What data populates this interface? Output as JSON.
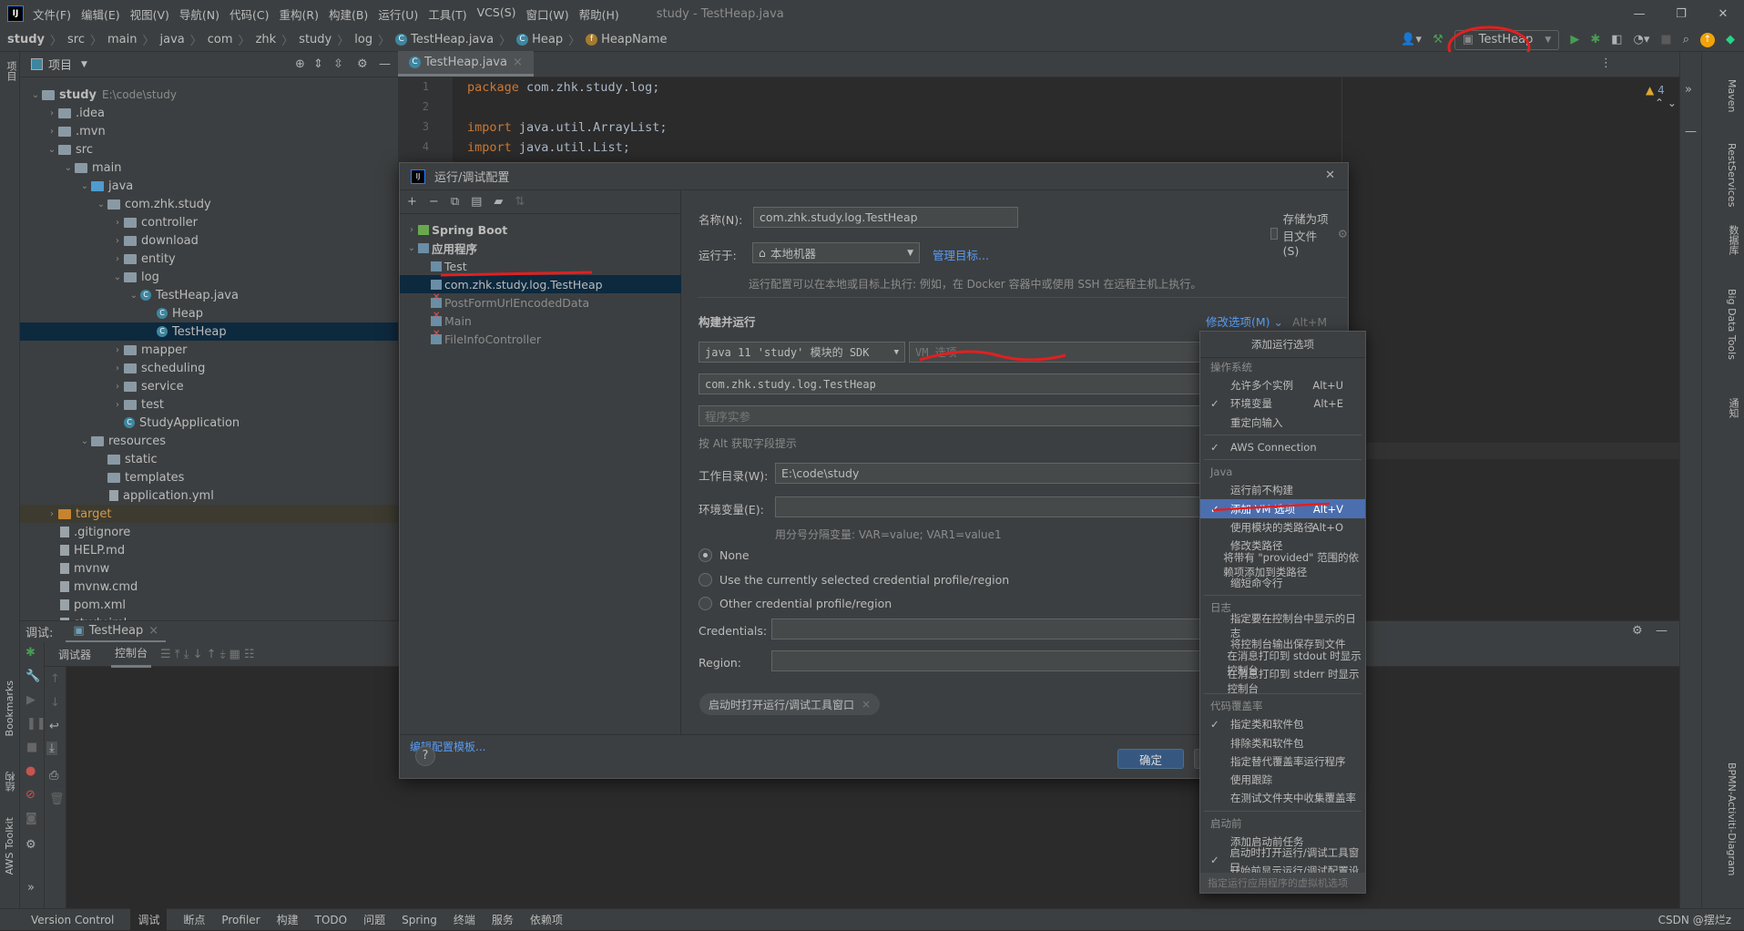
{
  "menubar": {
    "items": [
      "文件(F)",
      "编辑(E)",
      "视图(V)",
      "导航(N)",
      "代码(C)",
      "重构(R)",
      "构建(B)",
      "运行(U)",
      "工具(T)",
      "VCS(S)",
      "窗口(W)",
      "帮助(H)"
    ],
    "window_title": "study - TestHeap.java",
    "logo": "IJ"
  },
  "breadcrumb": [
    "study",
    "src",
    "main",
    "java",
    "com",
    "zhk",
    "study",
    "log",
    "TestHeap.java",
    "Heap",
    "HeapName"
  ],
  "toolbar": {
    "run_config": "TestHeap",
    "warnings": "4"
  },
  "project": {
    "title": "项目",
    "tree": [
      {
        "label": "study",
        "extra": "E:\\code\\study",
        "level": 0,
        "type": "folder",
        "open": true
      },
      {
        "label": ".idea",
        "level": 1,
        "type": "folder",
        "open": false
      },
      {
        "label": ".mvn",
        "level": 1,
        "type": "folder",
        "open": false
      },
      {
        "label": "src",
        "level": 1,
        "type": "folder",
        "open": true
      },
      {
        "label": "main",
        "level": 2,
        "type": "folder",
        "open": true
      },
      {
        "label": "java",
        "level": 3,
        "type": "src",
        "open": true
      },
      {
        "label": "com.zhk.study",
        "level": 4,
        "type": "folder",
        "open": true
      },
      {
        "label": "controller",
        "level": 5,
        "type": "folder",
        "open": false
      },
      {
        "label": "download",
        "level": 5,
        "type": "folder",
        "open": false
      },
      {
        "label": "entity",
        "level": 5,
        "type": "folder",
        "open": false
      },
      {
        "label": "log",
        "level": 5,
        "type": "folder",
        "open": true
      },
      {
        "label": "TestHeap.java",
        "level": 6,
        "type": "class",
        "open": true
      },
      {
        "label": "Heap",
        "level": 7,
        "type": "class"
      },
      {
        "label": "TestHeap",
        "level": 7,
        "type": "class",
        "selected": true
      },
      {
        "label": "mapper",
        "level": 5,
        "type": "folder",
        "open": false
      },
      {
        "label": "scheduling",
        "level": 5,
        "type": "folder",
        "open": false
      },
      {
        "label": "service",
        "level": 5,
        "type": "folder",
        "open": false
      },
      {
        "label": "test",
        "level": 5,
        "type": "folder",
        "open": false
      },
      {
        "label": "StudyApplication",
        "level": 5,
        "type": "class"
      },
      {
        "label": "resources",
        "level": 3,
        "type": "folder",
        "open": true
      },
      {
        "label": "static",
        "level": 4,
        "type": "folder"
      },
      {
        "label": "templates",
        "level": 4,
        "type": "folder"
      },
      {
        "label": "application.yml",
        "level": 4,
        "type": "file"
      },
      {
        "label": "target",
        "level": 1,
        "type": "target",
        "open": false,
        "ignored": true
      },
      {
        "label": ".gitignore",
        "level": 1,
        "type": "file"
      },
      {
        "label": "HELP.md",
        "level": 1,
        "type": "file"
      },
      {
        "label": "mvnw",
        "level": 1,
        "type": "file"
      },
      {
        "label": "mvnw.cmd",
        "level": 1,
        "type": "file"
      },
      {
        "label": "pom.xml",
        "level": 1,
        "type": "file"
      },
      {
        "label": "study.iml",
        "level": 1,
        "type": "file"
      }
    ]
  },
  "editor": {
    "tab": "TestHeap.java",
    "lines": [
      {
        "n": "1",
        "kw": "package",
        "rest": " com.zhk.study.log;"
      },
      {
        "n": "2",
        "kw": "",
        "rest": ""
      },
      {
        "n": "3",
        "kw": "import",
        "rest": " java.util.ArrayList;"
      },
      {
        "n": "4",
        "kw": "import",
        "rest": " java.util.List;"
      }
    ]
  },
  "left_strip": [
    "项目",
    "Bookmarks",
    "结构",
    "AWS Toolkit"
  ],
  "right_strip": [
    "Maven",
    "RestServices",
    "数据库",
    "Big Data Tools",
    "通知",
    "BPMN-Activiti-Diagram"
  ],
  "debug": {
    "label": "调试:",
    "tab": "TestHeap",
    "subtabs": [
      "调试器",
      "控制台"
    ]
  },
  "statusbar": {
    "items": [
      "Version Control",
      "调试",
      "断点",
      "Profiler",
      "构建",
      "TODO",
      "问题",
      "Spring",
      "终端",
      "服务",
      "依赖项"
    ],
    "watermark": "CSDN @摆烂z"
  },
  "dialog": {
    "title": "运行/调试配置",
    "tree": [
      {
        "label": "Spring Boot",
        "level": 0,
        "group": true
      },
      {
        "label": "应用程序",
        "level": 0,
        "group": true,
        "open": true
      },
      {
        "label": "Test",
        "level": 1
      },
      {
        "label": "com.zhk.study.log.TestHeap",
        "level": 1,
        "selected": true
      },
      {
        "label": "PostFormUrlEncodedData",
        "level": 1,
        "error": true
      },
      {
        "label": "Main",
        "level": 1,
        "error": true
      },
      {
        "label": "FileInfoController",
        "level": 1,
        "error": true
      }
    ],
    "edit_templates": "编辑配置模板...",
    "name_label": "名称(N):",
    "name_value": "com.zhk.study.log.TestHeap",
    "store_label": "存储为项目文件(S)",
    "run_on_label": "运行于:",
    "run_on_value": "本地机器",
    "manage_targets": "管理目标...",
    "run_on_hint": "运行配置可以在本地或目标上执行: 例如，在 Docker 容器中或使用 SSH 在远程主机上执行。",
    "build_run": "构建并运行",
    "modify_options": "修改选项(M)",
    "modify_shortcut": "Alt+M",
    "jdk": "java 11 'study' 模块的 SDK",
    "vm_placeholder": "VM 选项",
    "main_class": "com.zhk.study.log.TestHeap",
    "args_placeholder": "程序实参",
    "alt_hint": "按 Alt 获取字段提示",
    "workdir_label": "工作目录(W):",
    "workdir_value": "E:\\code\\study",
    "env_label": "环境变量(E):",
    "env_hint": "用分号分隔变量: VAR=value; VAR1=value1",
    "radios": [
      {
        "label": "None",
        "checked": true
      },
      {
        "label": "Use the currently selected credential profile/region",
        "checked": false
      },
      {
        "label": "Other credential profile/region",
        "checked": false
      }
    ],
    "credentials_label": "Credentials:",
    "region_label": "Region:",
    "chip": "启动时打开运行/调试工具窗口",
    "ok": "确定"
  },
  "popup": {
    "title": "添加运行选项",
    "sections": [
      {
        "name": "操作系统",
        "items": [
          {
            "label": "允许多个实例",
            "shortcut": "Alt+U"
          },
          {
            "label": "环境变量",
            "shortcut": "Alt+E",
            "checked": true
          },
          {
            "label": "重定向输入"
          }
        ]
      },
      {
        "name": "",
        "items": [
          {
            "label": "AWS Connection",
            "checked": true
          }
        ]
      },
      {
        "name": "Java",
        "items": [
          {
            "label": "运行前不构建"
          },
          {
            "label": "添加 VM 选项",
            "shortcut": "Alt+V",
            "checked": true,
            "highlighted": true
          },
          {
            "label": "使用模块的类路径",
            "shortcut": "Alt+O"
          },
          {
            "label": "修改类路径"
          },
          {
            "label": "将带有 \"provided\" 范围的依赖项添加到类路径"
          },
          {
            "label": "缩短命令行"
          }
        ]
      },
      {
        "name": "日志",
        "items": [
          {
            "label": "指定要在控制台中显示的日志"
          },
          {
            "label": "将控制台输出保存到文件"
          },
          {
            "label": "在消息打印到 stdout 时显示控制台"
          },
          {
            "label": "在消息打印到 stderr 时显示控制台"
          }
        ]
      },
      {
        "name": "代码覆盖率",
        "items": [
          {
            "label": "指定类和软件包",
            "checked": true
          },
          {
            "label": "排除类和软件包"
          },
          {
            "label": "指定替代覆盖率运行程序"
          },
          {
            "label": "使用跟踪"
          },
          {
            "label": "在测试文件夹中收集覆盖率"
          }
        ]
      },
      {
        "name": "启动前",
        "items": [
          {
            "label": "添加启动前任务"
          },
          {
            "label": "启动时打开运行/调试工具窗口",
            "checked": true
          },
          {
            "label": "开始前显示运行/调试配置设置"
          }
        ]
      }
    ],
    "footer": "指定运行应用程序的虚拟机选项"
  },
  "colors": {
    "accent": "#4b6eaf",
    "selection": "#0d293e",
    "annotation": "#e02020",
    "link": "#589df6"
  }
}
